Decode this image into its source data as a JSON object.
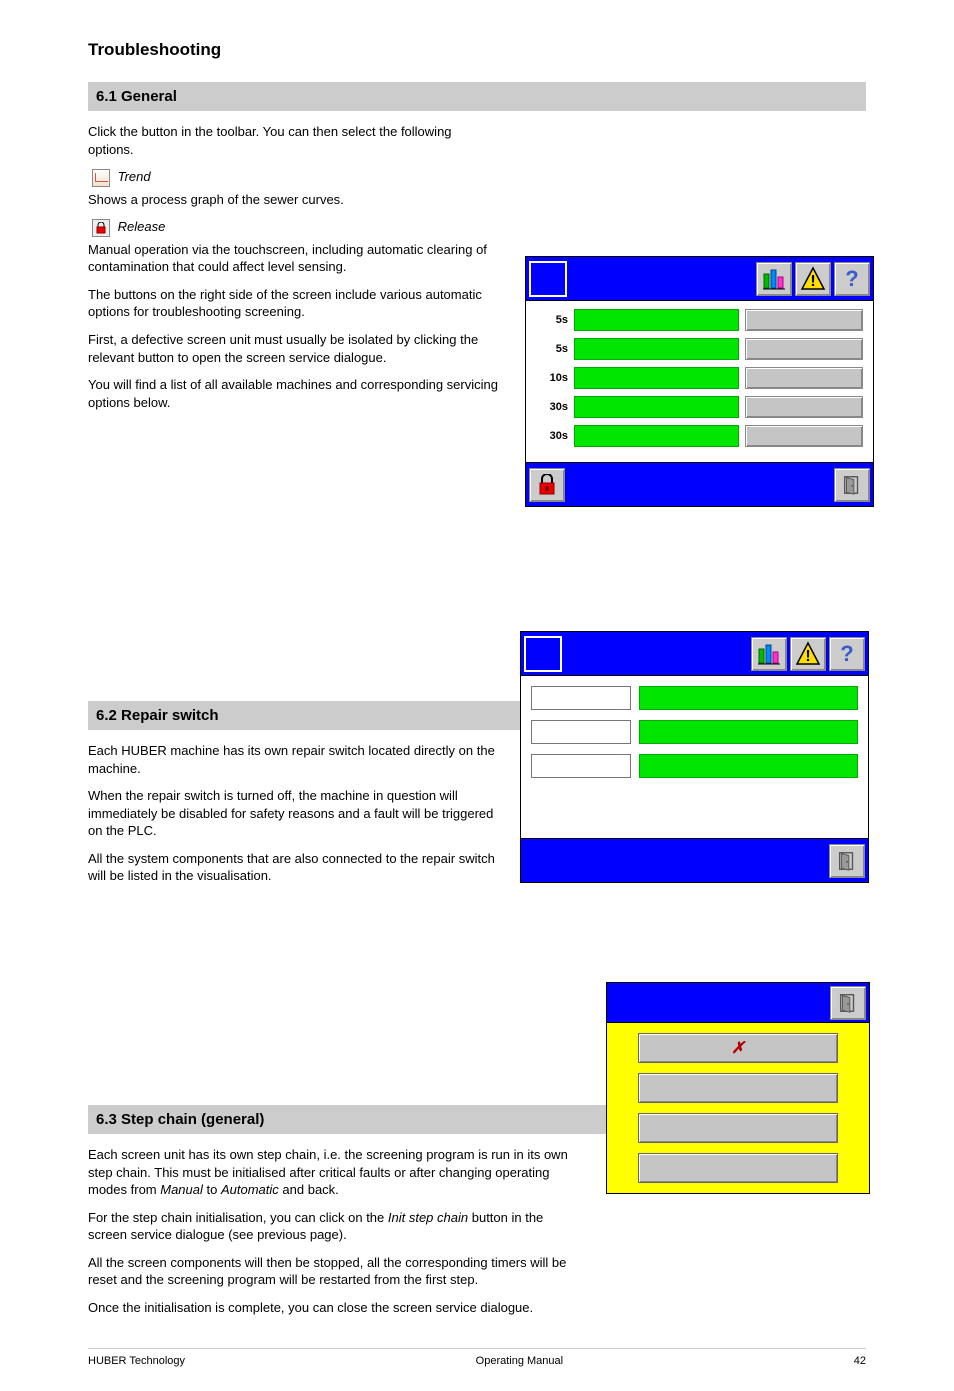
{
  "page": {
    "title": "Troubleshooting"
  },
  "sections": {
    "s1": {
      "heading": "6.1 General",
      "para1_a": "Click the           button in the toolbar. You can then select the following options.",
      "trend_btn_text": "Trend",
      "para2": "Shows a process graph of the sewer curves.",
      "para3": "Manual operation via the touchscreen, including automatic clearing of contamination that could affect level sensing.",
      "lock_btn_text": "Release",
      "para4": "The buttons on the right side of the screen include various automatic options for troubleshooting screening.",
      "para5": "First, a defective screen unit must usually be isolated by clicking the relevant        button to open the screen service dialogue.",
      "para6": "You will find a list of all available machines and corresponding servicing options below."
    },
    "s2": {
      "heading": "6.2 Repair switch",
      "para1": "Each HUBER machine has its own repair switch located directly on the machine.",
      "para2": "When the repair switch is turned off, the machine in question will immediately be disabled for safety reasons and a fault will be triggered on the PLC.",
      "para3": "All the system components that are also connected to the repair switch will be listed in the visualisation."
    },
    "s3": {
      "heading": "6.3 Step chain (general)",
      "para1a": "Each screen unit has its own step chain, i.e. the screening program is run in its own step chain. This must be initialised after critical faults or after changing operating modes from ",
      "para1b": " to ",
      "para1c": " and back.",
      "mode1": "Manual",
      "mode2": "Automatic",
      "para2a": "For the step chain initialisation, you can click on the ",
      "para2b": " button in the screen service dialogue (see previous page).",
      "init_label": "Init step chain",
      "para3": "All the screen components will then be stopped, all the corresponding timers will be reset and the screening program will be restarted from the first step.",
      "para4": "Once the initialisation is complete, you can close the screen service dialogue."
    }
  },
  "panel1": {
    "rows": [
      {
        "dur": "5s"
      },
      {
        "dur": "5s"
      },
      {
        "dur": "10s"
      },
      {
        "dur": "30s"
      },
      {
        "dur": "30s"
      }
    ]
  },
  "footer": {
    "left": "HUBER Technology",
    "center": "Operating Manual",
    "right": "42"
  }
}
